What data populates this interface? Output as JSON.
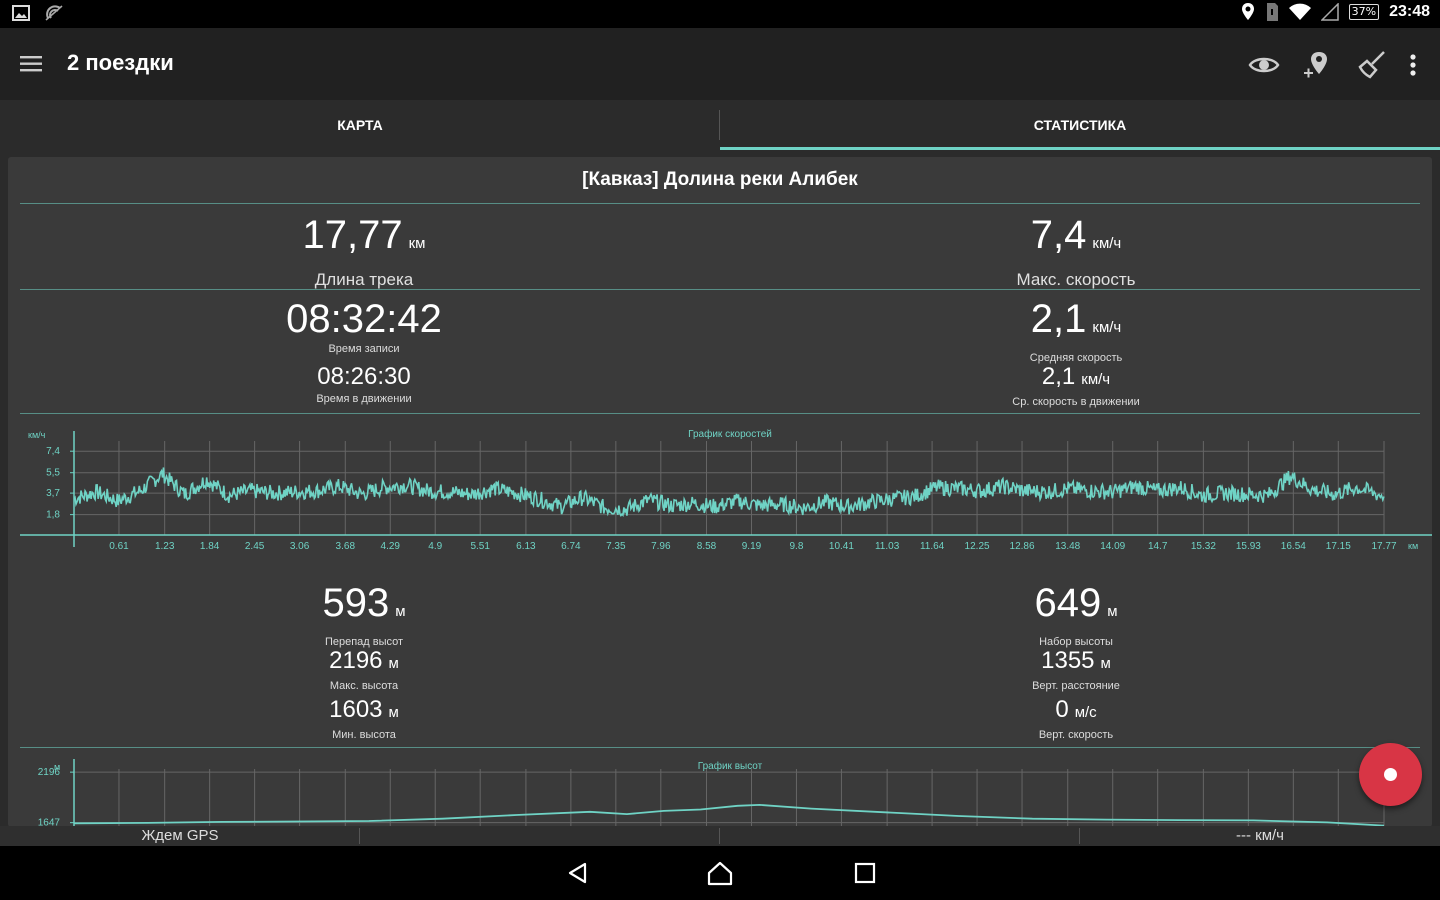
{
  "status_bar": {
    "time": "23:48",
    "battery": "37%",
    "icons": [
      "image-icon",
      "signal-broadcast-icon",
      "location-icon",
      "sim-icon",
      "wifi-icon",
      "cell-signal-icon"
    ]
  },
  "app_bar": {
    "title": "2 поездки",
    "actions": [
      "eye-icon",
      "add-location-icon",
      "broom-icon",
      "more-vert-icon"
    ]
  },
  "tabs": [
    {
      "label": "КАРТА",
      "active": false
    },
    {
      "label": "СТАТИСТИКА",
      "active": true
    }
  ],
  "accent_color": "#6fd3c5",
  "fab_color": "#d83545",
  "track": {
    "title": "[Кавказ] Долина реки Алибек",
    "length": {
      "value": "17,77",
      "unit": "км",
      "label": "Длина трека"
    },
    "max_speed": {
      "value": "7,4",
      "unit": "км/ч",
      "label": "Макс. скорость"
    },
    "record_time": {
      "value": "08:32:42",
      "label": "Время записи"
    },
    "avg_speed": {
      "value": "2,1",
      "unit": "км/ч",
      "label": "Средняя скорость"
    },
    "moving_time": {
      "value": "08:26:30",
      "label": "Время в движении"
    },
    "avg_moving_speed": {
      "value": "2,1",
      "unit": "км/ч",
      "label": "Ср. скорость в движении"
    },
    "elev_diff": {
      "value": "593",
      "unit": "м",
      "label": "Перепад высот"
    },
    "elev_gain": {
      "value": "649",
      "unit": "м",
      "label": "Набор высоты"
    },
    "max_alt": {
      "value": "2196",
      "unit": "м",
      "label": "Макс. высота"
    },
    "vert_dist": {
      "value": "1355",
      "unit": "м",
      "label": "Верт. расстояние"
    },
    "min_alt": {
      "value": "1603",
      "unit": "м",
      "label": "Мин. высота"
    },
    "vert_speed": {
      "value": "0",
      "unit": "м/с",
      "label": "Верт. скорость"
    }
  },
  "chart_data": [
    {
      "type": "line",
      "title": "График скоростей",
      "ylabel": "км/ч",
      "xlabel": "км",
      "ylim": [
        0,
        8.3
      ],
      "y_ticks": [
        "1,8",
        "3,7",
        "5,5",
        "7,4"
      ],
      "y_tick_values": [
        1.8,
        3.7,
        5.5,
        7.4
      ],
      "x_ticks": [
        "0.61",
        "1.23",
        "1.84",
        "2.45",
        "3.06",
        "3.68",
        "4.29",
        "4.9",
        "5.51",
        "6.13",
        "6.74",
        "7.35",
        "7.96",
        "8.58",
        "9.19",
        "9.8",
        "10.41",
        "11.03",
        "11.64",
        "12.25",
        "12.86",
        "13.48",
        "14.09",
        "14.7",
        "15.32",
        "15.93",
        "16.54",
        "17.15",
        "17.77"
      ],
      "grid": true,
      "series": [
        {
          "x": [
            0,
            0.3,
            0.6,
            0.9,
            1.2,
            1.5,
            1.8,
            2.1,
            2.4,
            2.7,
            3.0,
            3.3,
            3.6,
            3.9,
            4.2,
            4.5,
            4.8,
            5.1,
            5.4,
            5.7,
            6.0,
            6.3,
            6.6,
            6.9,
            7.2,
            7.5,
            7.8,
            8.1,
            8.4,
            8.7,
            9.0,
            9.3,
            9.6,
            9.9,
            10.2,
            10.5,
            10.8,
            11.1,
            11.4,
            11.7,
            12.0,
            12.3,
            12.6,
            12.9,
            13.2,
            13.5,
            13.8,
            14.1,
            14.4,
            14.7,
            15.0,
            15.3,
            15.6,
            15.9,
            16.2,
            16.5,
            16.8,
            17.1,
            17.4,
            17.77
          ],
          "values": [
            3.2,
            3.8,
            3.0,
            3.9,
            5.4,
            3.6,
            4.9,
            3.5,
            3.9,
            3.7,
            3.8,
            3.9,
            4.3,
            3.6,
            4.2,
            4.4,
            3.9,
            3.8,
            3.6,
            4.1,
            3.7,
            3.2,
            2.5,
            3.3,
            2.4,
            2.3,
            3.1,
            2.6,
            2.8,
            2.5,
            3.0,
            2.6,
            2.7,
            2.4,
            2.9,
            2.5,
            2.9,
            3.2,
            3.4,
            4.2,
            4.1,
            3.9,
            4.3,
            3.9,
            3.8,
            4.1,
            3.9,
            3.8,
            4.3,
            3.9,
            4.2,
            3.5,
            3.7,
            3.6,
            3.5,
            5.2,
            4.0,
            3.6,
            4.2,
            3.4
          ]
        }
      ]
    },
    {
      "type": "line",
      "title": "График высот",
      "ylabel": "м",
      "ylim": [
        1600,
        2230
      ],
      "y_ticks": [
        "1647",
        "2196"
      ],
      "y_tick_values": [
        1647,
        2196
      ],
      "grid": true,
      "series": [
        {
          "x": [
            0,
            1,
            2,
            3,
            4,
            5,
            6,
            7,
            7.5,
            8,
            8.5,
            9,
            9.3,
            10,
            11,
            12,
            13,
            14,
            15,
            16,
            17,
            17.77
          ],
          "values": [
            1640,
            1645,
            1655,
            1660,
            1665,
            1690,
            1730,
            1765,
            1740,
            1775,
            1790,
            1830,
            1840,
            1800,
            1760,
            1720,
            1690,
            1680,
            1675,
            1672,
            1650,
            1615
          ]
        }
      ]
    }
  ],
  "bottom_status": {
    "gps": "Ждем GPS",
    "speed": "--- км/ч"
  },
  "nav": [
    "back-icon",
    "home-icon",
    "recents-icon"
  ]
}
